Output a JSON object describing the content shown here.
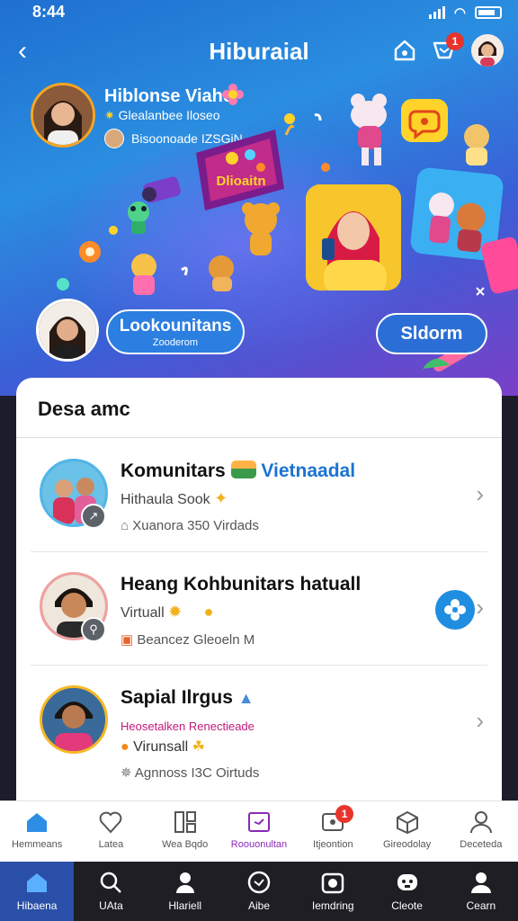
{
  "status_bar": {
    "time": "8:44"
  },
  "header": {
    "title": "Hiburaial",
    "notification_count": "1"
  },
  "profile": {
    "name": "Hiblonse Viahe",
    "subtitle": "Glealanbee Iloseo",
    "meta": "Bisoonoade IZSGiN"
  },
  "hero": {
    "kite_label": "Dlioaitn",
    "pill_left_title": "Lookounitans",
    "pill_left_sub": "Zooderom",
    "pill_right_label": "Sldorm"
  },
  "section": {
    "title": "Desa amc",
    "items": [
      {
        "title": "Komunitars",
        "title_accent": "Vietnaadal",
        "line2": "Hithaula Sook",
        "line3": "Xuanora 350 Virdads"
      },
      {
        "title": "Heang Kohbunitars hatuall",
        "title_accent": "",
        "line2": "Virtuall",
        "line3": "Beancez Gleoeln M"
      },
      {
        "title": "Sapial Ilrgus",
        "title_accent": "",
        "line2": "Heosetalken Renectieade",
        "line3_a": "Virunsall",
        "line3": "Agnnoss I3C Oirtuds"
      }
    ]
  },
  "tabbar_top": {
    "tabs": [
      {
        "label": "Hemmeans",
        "icon": "home-icon"
      },
      {
        "label": "Latea",
        "icon": "heart-icon"
      },
      {
        "label": "Wea Bqdo",
        "icon": "grid-icon"
      },
      {
        "label": "Roouonultan",
        "icon": "calendar-icon"
      },
      {
        "label": "Itjeontion",
        "icon": "chat-icon"
      },
      {
        "label": "Gireodolay",
        "icon": "box-icon"
      },
      {
        "label": "Deceteda",
        "icon": "person-icon"
      }
    ],
    "badge": "1",
    "active_color": "#8a2ab7"
  },
  "tabbar_bottom": {
    "tabs": [
      {
        "label": "Hibaena"
      },
      {
        "label": "UAta"
      },
      {
        "label": "Hlariell"
      },
      {
        "label": "Aibe"
      },
      {
        "label": "Iemdring"
      },
      {
        "label": "Cleote"
      },
      {
        "label": "Cearn"
      }
    ]
  }
}
